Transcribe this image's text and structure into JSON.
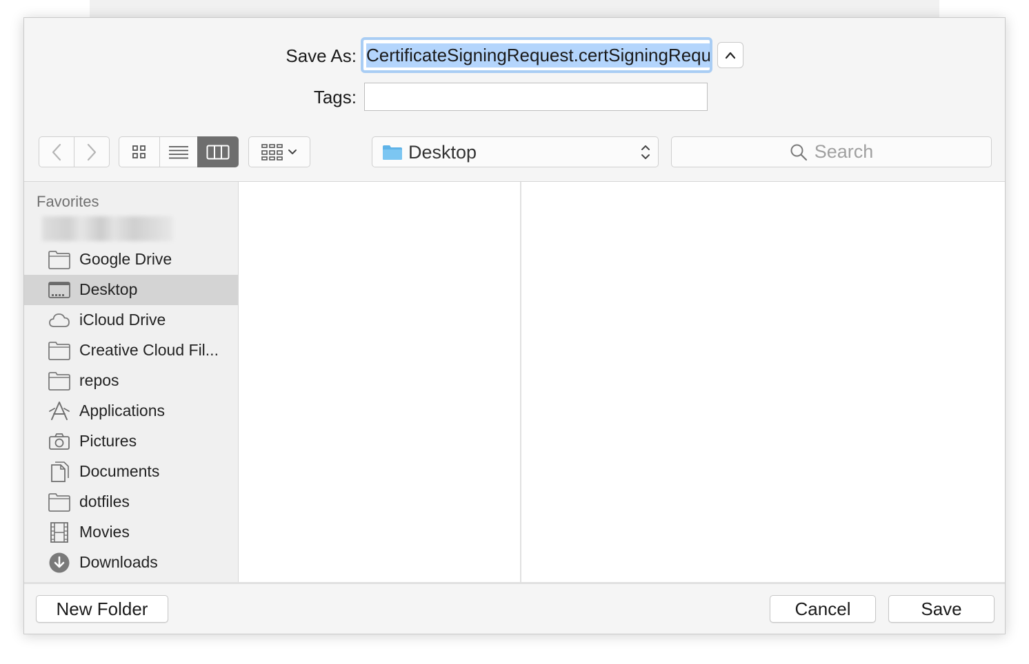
{
  "save_as": {
    "label": "Save As:",
    "value": "CertificateSigningRequest.certSigningRequest"
  },
  "tags": {
    "label": "Tags:",
    "value": ""
  },
  "toolbar": {
    "location": "Desktop",
    "search_placeholder": "Search",
    "active_view": "column"
  },
  "sidebar": {
    "heading": "Favorites",
    "items": [
      {
        "label": "Google Drive",
        "icon": "folder-icon"
      },
      {
        "label": "Desktop",
        "icon": "desktop-icon",
        "selected": true
      },
      {
        "label": "iCloud Drive",
        "icon": "cloud-icon"
      },
      {
        "label": "Creative Cloud Fil...",
        "icon": "folder-icon"
      },
      {
        "label": "repos",
        "icon": "folder-icon"
      },
      {
        "label": "Applications",
        "icon": "applications-icon"
      },
      {
        "label": "Pictures",
        "icon": "camera-icon"
      },
      {
        "label": "Documents",
        "icon": "documents-icon"
      },
      {
        "label": "dotfiles",
        "icon": "folder-icon"
      },
      {
        "label": "Movies",
        "icon": "film-icon"
      },
      {
        "label": "Downloads",
        "icon": "download-icon"
      }
    ]
  },
  "footer": {
    "new_folder": "New Folder",
    "cancel": "Cancel",
    "save": "Save"
  },
  "colors": {
    "selection": "#b4d5fc",
    "focus_ring": "#a9cdf4",
    "folder_blue": "#5fb3e8"
  }
}
